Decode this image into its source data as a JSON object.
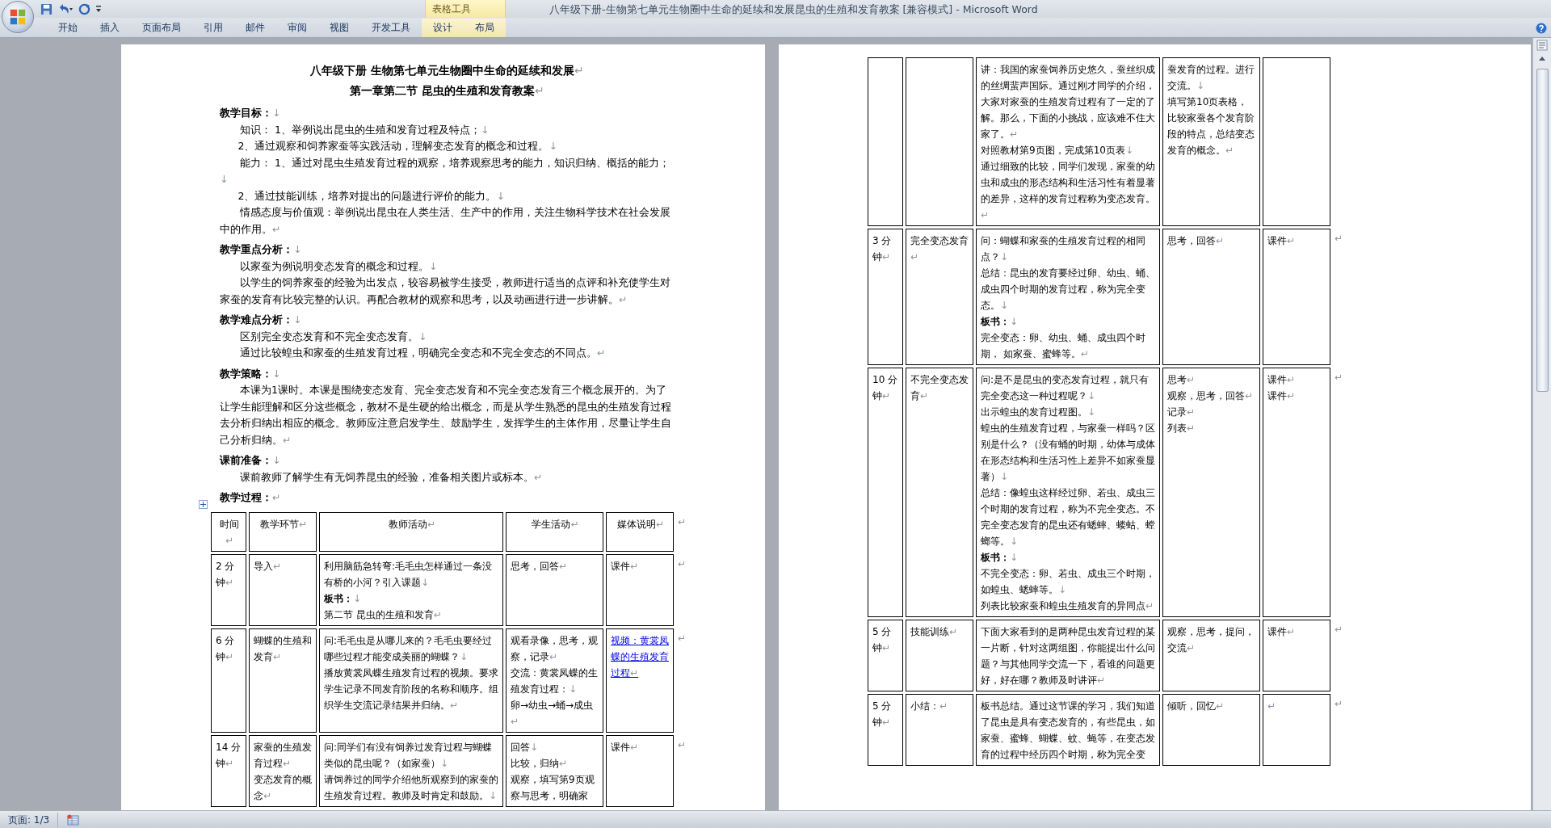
{
  "window": {
    "title": "八年级下册-生物第七单元生物圈中生命的延续和发展昆虫的生殖和发育教案 [兼容模式] - Microsoft Word"
  },
  "ribbon": {
    "context_group": "表格工具",
    "tabs": [
      {
        "label": "开始",
        "contextual": false
      },
      {
        "label": "插入",
        "contextual": false
      },
      {
        "label": "页面布局",
        "contextual": false
      },
      {
        "label": "引用",
        "contextual": false
      },
      {
        "label": "邮件",
        "contextual": false
      },
      {
        "label": "审阅",
        "contextual": false
      },
      {
        "label": "视图",
        "contextual": false
      },
      {
        "label": "开发工具",
        "contextual": false
      },
      {
        "label": "设计",
        "contextual": true
      },
      {
        "label": "布局",
        "contextual": true
      }
    ]
  },
  "pages": [
    {
      "blocks": [
        {
          "kind": "title",
          "text": "八年级下册 生物第七单元生物圈中生命的延续和发展",
          "end": "↵"
        },
        {
          "kind": "title",
          "text": "第一章第二节 昆虫的生殖和发育教案",
          "end": "↵"
        },
        {
          "kind": "heading",
          "text": "教学目标：",
          "end": "↓"
        },
        {
          "kind": "para",
          "text": "知识： 1、举例说出昆虫的生殖和发育过程及特点；",
          "end": "↓"
        },
        {
          "kind": "item",
          "text": "2、通过观察和饲养家蚕等实践活动，理解变态发育的概念和过程。",
          "end": "↓"
        },
        {
          "kind": "para",
          "text": "能力： 1、通过对昆虫生殖发育过程的观察，培养观察思考的能力，知识归纳、概括的能力；",
          "end": "↓"
        },
        {
          "kind": "item",
          "text": "2、通过技能训练，培养对提出的问题进行评价的能力。",
          "end": "↓"
        },
        {
          "kind": "para",
          "text": "情感态度与价值观：举例说出昆虫在人类生活、生产中的作用，关注生物科学技术在社会发展中的作用。",
          "end": "↵"
        },
        {
          "kind": "heading",
          "text": "教学重点分析：",
          "end": "↓"
        },
        {
          "kind": "para",
          "text": "以家蚕为例说明变态发育的概念和过程。",
          "end": "↓"
        },
        {
          "kind": "para",
          "text": "以学生的饲养家蚕的经验为出发点，较容易被学生接受，教师进行适当的点评和补充使学生对家蚕的发育有比较完整的认识。再配合教材的观察和思考，以及动画进行进一步讲解。",
          "end": "↵"
        },
        {
          "kind": "heading",
          "text": "教学难点分析：",
          "end": "↓"
        },
        {
          "kind": "para",
          "text": "区别完全变态发育和不完全变态发育。",
          "end": "↓"
        },
        {
          "kind": "para",
          "text": "通过比较蝗虫和家蚕的生殖发育过程，明确完全变态和不完全变态的不同点。",
          "end": "↵"
        },
        {
          "kind": "heading",
          "text": "教学策略：",
          "end": "↓"
        },
        {
          "kind": "para",
          "text": "本课为1课时。本课是围绕变态发育、完全变态发育和不完全变态发育三个概念展开的。为了让学生能理解和区分这些概念，教材不是生硬的给出概念，而是从学生熟悉的昆虫的生殖发育过程去分析归纳出相应的概念。教师应注意启发学生、鼓励学生，发挥学生的主体作用，尽量让学生自己分析归纳。",
          "end": "↵"
        },
        {
          "kind": "heading",
          "text": "课前准备：",
          "end": "↓"
        },
        {
          "kind": "para",
          "text": "课前教师了解学生有无饲养昆虫的经验，准备相关图片或标本。",
          "end": "↵"
        },
        {
          "kind": "heading",
          "text": "教学过程：",
          "end": "↵"
        },
        {
          "kind": "table",
          "rows": [
            {
              "kind": "header",
              "end": "↵",
              "cells": [
                [
                  {
                    "text": "时间",
                    "end": "↵",
                    "kind": "text"
                  }
                ],
                [
                  {
                    "text": "教学环节",
                    "end": "↵",
                    "kind": "text"
                  }
                ],
                [
                  {
                    "text": "教师活动",
                    "end": "↵",
                    "kind": "text"
                  }
                ],
                [
                  {
                    "text": "学生活动",
                    "end": "↵",
                    "kind": "text"
                  }
                ],
                [
                  {
                    "text": "媒体说明",
                    "end": "↵",
                    "kind": "text"
                  }
                ]
              ]
            },
            {
              "kind": "body",
              "end": "↵",
              "cells": [
                [
                  {
                    "text": "2 分钟",
                    "end": "↵",
                    "kind": "text"
                  }
                ],
                [
                  {
                    "text": "导入",
                    "end": "↵",
                    "kind": "text"
                  }
                ],
                [
                  {
                    "text": "利用脑筋急转弯:毛毛虫怎样通过一条没有桥的小河？引入课题",
                    "end": "↓",
                    "kind": "text"
                  },
                  {
                    "text": "板书：",
                    "end": "↓",
                    "kind": "bold"
                  },
                  {
                    "text": "第二节 昆虫的生殖和发育",
                    "end": "↵",
                    "kind": "text"
                  }
                ],
                [
                  {
                    "text": "思考，回答",
                    "end": "↵",
                    "kind": "text"
                  }
                ],
                [
                  {
                    "text": "课件",
                    "end": "↵",
                    "kind": "text"
                  }
                ]
              ]
            },
            {
              "kind": "body",
              "end": "↵",
              "cells": [
                [
                  {
                    "text": "6 分钟",
                    "end": "↵",
                    "kind": "text"
                  }
                ],
                [
                  {
                    "text": "蝴蝶的生殖和发育",
                    "end": "↵",
                    "kind": "text"
                  }
                ],
                [
                  {
                    "text": "问:毛毛虫是从哪儿来的？毛毛虫要经过哪些过程才能变成美丽的蝴蝶？",
                    "end": "↓",
                    "kind": "text"
                  },
                  {
                    "text": "播放黄裳凤蝶生殖发育过程的视频。要求学生记录不同发育阶段的名称和顺序。组织学生交流记录结果并归纳。",
                    "end": "↵",
                    "kind": "text"
                  }
                ],
                [
                  {
                    "text": "观看录像，思考，观察，记录",
                    "end": "↵",
                    "kind": "text"
                  },
                  {
                    "text": "交流：黄裳凤蝶的生殖发育过程：",
                    "end": "↓",
                    "kind": "text"
                  },
                  {
                    "text": "卵→幼虫→蛹→成虫",
                    "end": "↵",
                    "kind": "text"
                  }
                ],
                [
                  {
                    "text": "视频：黄裳凤蝶的生殖发育过程",
                    "end": "↵",
                    "kind": "link"
                  }
                ]
              ]
            },
            {
              "kind": "body",
              "end": "↵",
              "cells": [
                [
                  {
                    "text": "14 分钟",
                    "end": "↵",
                    "kind": "text"
                  }
                ],
                [
                  {
                    "text": "家蚕的生殖发育过程",
                    "end": "↵",
                    "kind": "text"
                  },
                  {
                    "text": "变态发育的概念",
                    "end": "↵",
                    "kind": "text"
                  }
                ],
                [
                  {
                    "text": "问:同学们有没有饲养过发育过程与蝴蝶类似的昆虫呢？（如家蚕）",
                    "end": "↓",
                    "kind": "text"
                  },
                  {
                    "text": "请饲养过的同学介绍他所观察到的家蚕的生殖发育过程。教师及时肯定和鼓励。",
                    "end": "↓",
                    "kind": "text"
                  }
                ],
                [
                  {
                    "text": "回答",
                    "end": "↓",
                    "kind": "text"
                  },
                  {
                    "text": "比较，归纳",
                    "end": "↵",
                    "kind": "text"
                  },
                  {
                    "text": "观察，填写第9页观察与思考，明确家",
                    "kind": "text"
                  }
                ],
                [
                  {
                    "text": "课件",
                    "end": "↵",
                    "kind": "text"
                  }
                ]
              ]
            }
          ]
        }
      ]
    },
    {
      "blocks": [
        {
          "kind": "table",
          "rows": [
            {
              "kind": "body",
              "cells": [
                [],
                [],
                [
                  {
                    "text": "讲：我国的家蚕饲养历史悠久，蚕丝织成的丝绸蜚声国际。通过刚才同学的介绍，大家对家蚕的生殖发育过程有了一定的了解。那么，下面的小挑战，应该难不住大家了。",
                    "end": "↵",
                    "kind": "text"
                  },
                  {
                    "text": "对照教材第9页图，完成第10页表",
                    "end": "↓",
                    "kind": "text"
                  },
                  {
                    "text": "通过细致的比较，同学们发现，家蚕的幼虫和成虫的形态结构和生活习性有着显著的差异，这样的发育过程称为变态发育。",
                    "end": "↵",
                    "kind": "text"
                  }
                ],
                [
                  {
                    "text": "蚕发育的过程。进行交流。",
                    "end": "↓",
                    "kind": "text"
                  },
                  {
                    "text": "填写第10页表格，比较家蚕各个发育阶段的特点，总结变态发育的概念。",
                    "end": "↵",
                    "kind": "text"
                  }
                ],
                []
              ]
            },
            {
              "kind": "body",
              "end": "↵",
              "cells": [
                [
                  {
                    "text": "3 分钟",
                    "end": "↵",
                    "kind": "text"
                  }
                ],
                [
                  {
                    "text": "完全变态发育",
                    "end": "↵",
                    "kind": "text"
                  }
                ],
                [
                  {
                    "text": "问：蝴蝶和家蚕的生殖发育过程的相同点？",
                    "end": "↓",
                    "kind": "text"
                  },
                  {
                    "text": "总结：昆虫的发育要经过卵、幼虫、蛹、成虫四个时期的发育过程，称为完全变态。",
                    "end": "↓",
                    "kind": "text"
                  },
                  {
                    "text": "板书：",
                    "end": "↓",
                    "kind": "bold"
                  },
                  {
                    "text": "完全变态：卵、幼虫、蛹、成虫四个时期， 如家蚕、蜜蜂等。",
                    "end": "↵",
                    "kind": "text"
                  }
                ],
                [
                  {
                    "text": "思考，回答",
                    "end": "↵",
                    "kind": "text"
                  }
                ],
                [
                  {
                    "text": "课件",
                    "end": "↵",
                    "kind": "text"
                  }
                ]
              ]
            },
            {
              "kind": "body",
              "end": "↵",
              "cells": [
                [
                  {
                    "text": "10 分钟",
                    "end": "↵",
                    "kind": "text"
                  }
                ],
                [
                  {
                    "text": "不完全变态发育",
                    "end": "↵",
                    "kind": "text"
                  }
                ],
                [
                  {
                    "text": "问:是不是昆虫的变态发育过程，就只有完全变态这一种过程呢？",
                    "end": "↓",
                    "kind": "text"
                  },
                  {
                    "text": "出示蝗虫的发育过程图。",
                    "end": "↓",
                    "kind": "text"
                  },
                  {
                    "text": "蝗虫的生殖发育过程，与家蚕一样吗？区别是什么？（没有蛹的时期，幼体与成体在形态结构和生活习性上差异不如家蚕显著）",
                    "end": "↓",
                    "kind": "text"
                  },
                  {
                    "text": "总结：像蝗虫这样经过卵、若虫、成虫三个时期的发育过程，称为不完全变态。不完全变态发育的昆虫还有蟋蟀、蝼蛄、螳螂等。",
                    "end": "↓",
                    "kind": "text"
                  },
                  {
                    "text": "板书：",
                    "end": "↓",
                    "kind": "bold"
                  },
                  {
                    "text": "不完全变态：卵、若虫、成虫三个时期，如蝗虫、蟋蟀等。",
                    "end": "↓",
                    "kind": "text"
                  },
                  {
                    "text": "列表比较家蚕和蝗虫生殖发育的异同点",
                    "end": "↵",
                    "kind": "text"
                  }
                ],
                [
                  {
                    "text": "思考",
                    "end": "↵",
                    "kind": "text"
                  },
                  {
                    "text": "观察，思考，回答",
                    "end": "↵",
                    "kind": "text"
                  },
                  {
                    "text": "记录",
                    "end": "↵",
                    "kind": "text"
                  },
                  {
                    "text": "列表",
                    "end": "↵",
                    "kind": "text"
                  }
                ],
                [
                  {
                    "text": "课件",
                    "end": "↵",
                    "kind": "text"
                  },
                  {
                    "text": "课件",
                    "end": "↵",
                    "kind": "text"
                  }
                ]
              ]
            },
            {
              "kind": "body",
              "end": "↵",
              "cells": [
                [
                  {
                    "text": "5 分钟",
                    "end": "↵",
                    "kind": "text"
                  }
                ],
                [
                  {
                    "text": "技能训练",
                    "end": "↵",
                    "kind": "text"
                  }
                ],
                [
                  {
                    "text": "下面大家看到的是两种昆虫发育过程的某一片断，针对这两组图，你能提出什么问题？与其他同学交流一下，看谁的问题更好，好在哪？教师及时讲评",
                    "end": "↵",
                    "kind": "text"
                  }
                ],
                [
                  {
                    "text": "观察，思考，提问，交流",
                    "end": "↵",
                    "kind": "text"
                  }
                ],
                [
                  {
                    "text": "课件",
                    "end": "↵",
                    "kind": "text"
                  }
                ]
              ]
            },
            {
              "kind": "body",
              "end": "↵",
              "cells": [
                [
                  {
                    "text": "5 分钟",
                    "end": "↵",
                    "kind": "text"
                  }
                ],
                [
                  {
                    "text": "小结：",
                    "end": "↵",
                    "kind": "text"
                  }
                ],
                [
                  {
                    "text": "板书总结。通过这节课的学习，我们知道了昆虫是具有变态发育的，有些昆虫，如家蚕、蜜蜂、蝴蝶、蚊、蝇等，在变态发育的过程中经历四个时期，称为完全变",
                    "kind": "text"
                  }
                ],
                [
                  {
                    "text": "倾听，回忆",
                    "end": "↵",
                    "kind": "text"
                  }
                ],
                [
                  {
                    "end": "↵",
                    "kind": "text"
                  }
                ]
              ]
            }
          ]
        }
      ]
    }
  ],
  "status_bar": {
    "page": "页面: 1/3"
  }
}
